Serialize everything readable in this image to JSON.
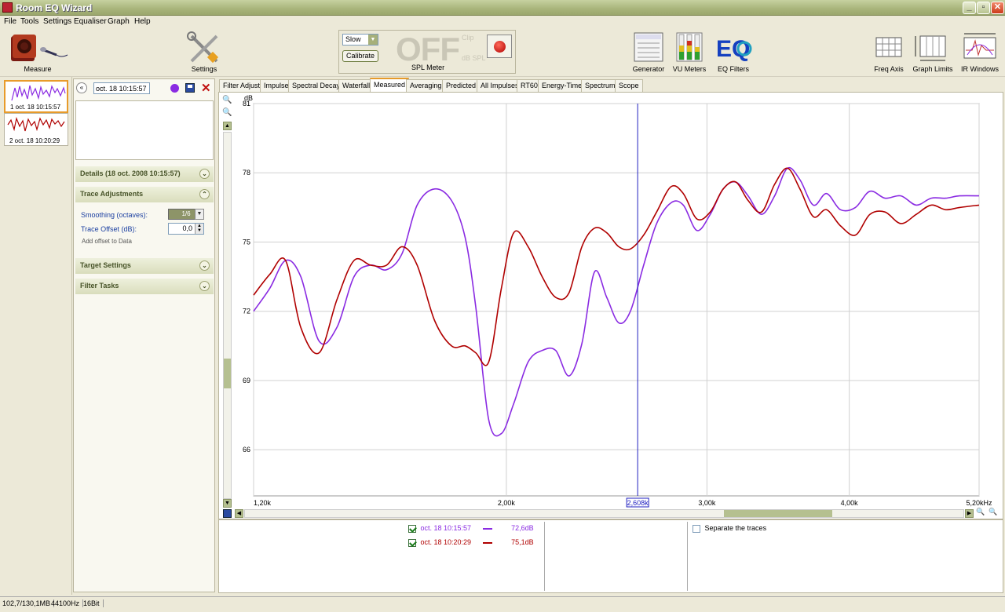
{
  "window": {
    "title": "Room EQ Wizard"
  },
  "menu": [
    "File",
    "Tools",
    "Settings",
    "Equaliser",
    "Graph",
    "Help"
  ],
  "toolbar": {
    "measure_label": "Measure",
    "settings_label": "Settings",
    "generator_label": "Generator",
    "vu_label": "VU Meters",
    "eq_label": "EQ Filters",
    "freq_axis_label": "Freq Axis",
    "graph_limits_label": "Graph Limits",
    "ir_windows_label": "IR Windows"
  },
  "spl_meter": {
    "speed": "Slow",
    "calibrate": "Calibrate",
    "value": "OFF",
    "clip": "Clip",
    "unit": "dB SPL",
    "label": "SPL Meter"
  },
  "measurements": [
    {
      "index": "1",
      "label": "1 oct. 18 10:15:57"
    },
    {
      "index": "2",
      "label": "2 oct. 18 10:20:29"
    }
  ],
  "panel": {
    "name_value": "oct. 18 10:15:57",
    "details": "Details  (18 oct. 2008 10:15:57)",
    "trace_adjustments": "Trace Adjustments",
    "smoothing_label": "Smoothing (octaves):",
    "smoothing_value": "1/6",
    "offset_label": "Trace Offset (dB):",
    "offset_value": "0,0",
    "add_offset": "Add offset to Data",
    "target_settings": "Target Settings",
    "filter_tasks": "Filter Tasks"
  },
  "tabs": [
    "Filter Adjust",
    "Impulse",
    "Spectral Decay",
    "Waterfall",
    "Measured",
    "Averaging",
    "Predicted",
    "All Impulses",
    "RT60",
    "Energy-Time",
    "Spectrum",
    "Scope"
  ],
  "active_tab": "Measured",
  "cursor": {
    "freq": 2.608,
    "readout": "2,608k"
  },
  "legend": [
    {
      "name": "oct. 18 10:15:57",
      "value": "72,6dB",
      "color": "#8a2be2"
    },
    {
      "name": "oct. 18 10:20:29",
      "value": "75,1dB",
      "color": "#b00000"
    }
  ],
  "separate_traces": "Separate the traces",
  "status": {
    "memory": "102,7/130,1MB",
    "rate": "44100Hz",
    "bits": "16Bit"
  },
  "chart_data": {
    "type": "line",
    "ylabel": "dB",
    "xunit": "Hz",
    "xscale": "log",
    "xlim": [
      1.2,
      5.2
    ],
    "ylim": [
      64,
      81
    ],
    "yticks": [
      66,
      69,
      72,
      75,
      78,
      81
    ],
    "ytick_labels": [
      "66",
      "69",
      "72",
      "75",
      "78",
      "81"
    ],
    "xticks": [
      1.2,
      2.0,
      3.0,
      4.0,
      5.2
    ],
    "xtick_labels": [
      "1,20k",
      "2,00k",
      "3,00k",
      "4,00k",
      "5,20kHz"
    ],
    "grid": true,
    "series": [
      {
        "name": "oct. 18 10:15:57",
        "color": "#8a2be2",
        "x": [
          1.2,
          1.24,
          1.28,
          1.32,
          1.37,
          1.42,
          1.47,
          1.52,
          1.57,
          1.62,
          1.67,
          1.73,
          1.79,
          1.84,
          1.88,
          1.93,
          1.98,
          2.03,
          2.09,
          2.15,
          2.21,
          2.27,
          2.33,
          2.39,
          2.45,
          2.51,
          2.57,
          2.64,
          2.71,
          2.79,
          2.86,
          2.94,
          3.02,
          3.1,
          3.18,
          3.26,
          3.35,
          3.44,
          3.53,
          3.62,
          3.72,
          3.82,
          3.93,
          4.05,
          4.17,
          4.3,
          4.44,
          4.58,
          4.72,
          4.86,
          5.0,
          5.2
        ],
        "y": [
          72.0,
          73.0,
          74.2,
          73.5,
          70.7,
          71.3,
          73.5,
          74.0,
          73.8,
          74.5,
          76.6,
          77.3,
          76.8,
          75.2,
          72.2,
          67.3,
          66.7,
          68.0,
          69.8,
          70.3,
          70.3,
          69.2,
          70.6,
          73.7,
          72.6,
          71.5,
          72.0,
          74.0,
          75.8,
          76.7,
          76.6,
          75.5,
          76.2,
          77.3,
          77.6,
          77.0,
          76.2,
          77.0,
          78.2,
          77.7,
          76.6,
          77.1,
          76.4,
          76.5,
          77.2,
          76.9,
          77.0,
          76.6,
          76.9,
          76.9,
          77.0,
          77.0
        ]
      },
      {
        "name": "oct. 18 10:20:29",
        "color": "#b00000",
        "x": [
          1.2,
          1.24,
          1.28,
          1.32,
          1.37,
          1.42,
          1.47,
          1.52,
          1.57,
          1.62,
          1.67,
          1.73,
          1.79,
          1.84,
          1.88,
          1.93,
          1.98,
          2.03,
          2.09,
          2.15,
          2.21,
          2.27,
          2.33,
          2.39,
          2.45,
          2.51,
          2.57,
          2.64,
          2.71,
          2.79,
          2.86,
          2.94,
          3.02,
          3.1,
          3.18,
          3.26,
          3.35,
          3.44,
          3.53,
          3.62,
          3.72,
          3.82,
          3.93,
          4.05,
          4.17,
          4.3,
          4.44,
          4.58,
          4.72,
          4.86,
          5.0,
          5.2
        ],
        "y": [
          72.7,
          73.6,
          74.2,
          71.3,
          70.2,
          72.5,
          74.2,
          74.0,
          74.0,
          74.8,
          74.0,
          71.6,
          70.5,
          70.5,
          70.2,
          69.8,
          73.0,
          75.4,
          74.8,
          73.5,
          72.6,
          72.8,
          74.8,
          75.6,
          75.4,
          74.8,
          74.7,
          75.3,
          76.3,
          77.4,
          77.1,
          76.0,
          76.3,
          77.3,
          77.6,
          76.8,
          76.3,
          77.5,
          78.2,
          77.3,
          76.1,
          76.4,
          75.7,
          75.3,
          76.2,
          76.3,
          75.8,
          76.2,
          76.6,
          76.4,
          76.5,
          76.6
        ]
      }
    ]
  }
}
